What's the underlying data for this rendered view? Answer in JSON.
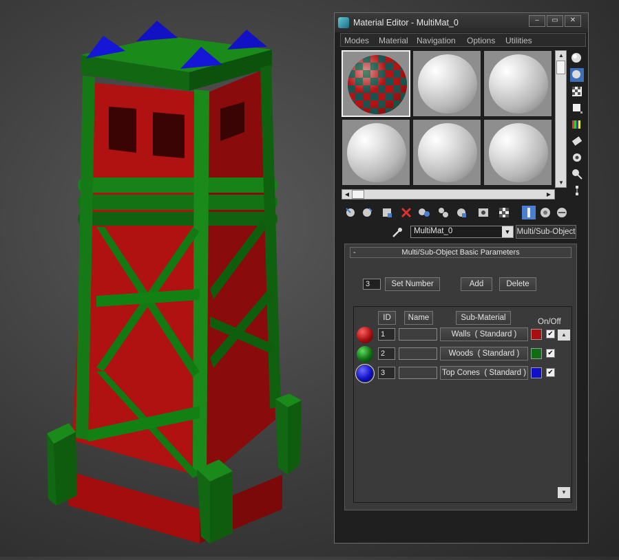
{
  "window": {
    "title": "Material Editor - MultiMat_0",
    "controls": {
      "minimize": "–",
      "maximize": "▭",
      "close": "✕"
    }
  },
  "menu": [
    "Modes",
    "Material",
    "Navigation",
    "Options",
    "Utilities"
  ],
  "material": {
    "name": "MultiMat_0",
    "type": "Multi/Sub-Object"
  },
  "rollout": {
    "title": "Multi/Sub-Object Basic Parameters",
    "collapse": "-",
    "count": "3",
    "set_number": "Set Number",
    "add": "Add",
    "delete": "Delete"
  },
  "list": {
    "headers": {
      "id": "ID",
      "name": "Name",
      "sub_material": "Sub-Material",
      "on_off": "On/Off"
    },
    "rows": [
      {
        "id": "1",
        "name": "",
        "sub_material": "Walls  ( Standard )",
        "color": "#a80f0f",
        "on": true
      },
      {
        "id": "2",
        "name": "",
        "sub_material": "Woods  ( Standard )",
        "color": "#0f6e12",
        "on": true
      },
      {
        "id": "3",
        "name": "",
        "sub_material": "Top Cones  ( Standard )",
        "color": "#1010c8",
        "on": true
      }
    ]
  },
  "icons": {
    "right_tools": [
      "sample-type-icon",
      "backlight-icon",
      "background-icon",
      "uv-tiling-icon",
      "video-color-check-icon",
      "make-preview-icon",
      "options-icon",
      "select-by-material-icon",
      "material-map-navigator-icon"
    ],
    "toolbar": [
      "get-material-icon",
      "put-material-icon",
      "assign-material-icon",
      "reset-map-icon",
      "make-unique-icon",
      "put-to-library-icon",
      "material-id-channel-icon",
      "show-shaded-icon",
      "show-end-result-icon",
      "go-to-parent-icon",
      "go-forward-sibling-icon",
      "background-toggle-icon"
    ]
  },
  "colors": {
    "accent": "#4a7fd0",
    "tower_red": "#b01010",
    "tower_green": "#116a11",
    "tower_blue": "#0e14c8"
  }
}
